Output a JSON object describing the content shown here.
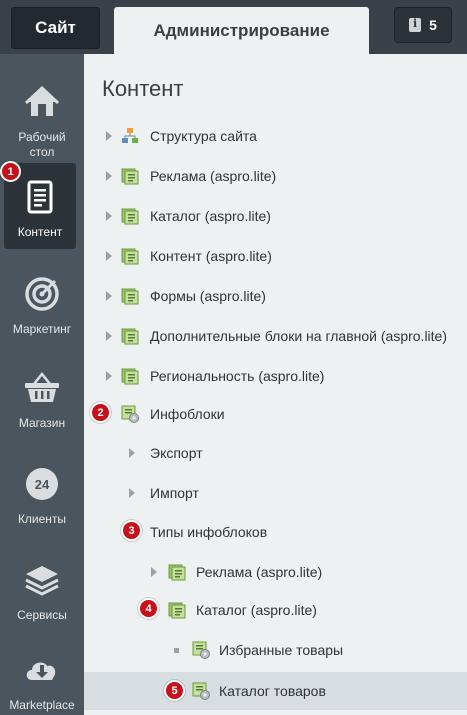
{
  "topbar": {
    "site_tab": "Сайт",
    "admin_tab": "Администрирование",
    "notifications_count": "5"
  },
  "sidebar": {
    "items": [
      {
        "label_line1": "Рабочий",
        "label_line2": "стол",
        "icon": "home-icon"
      },
      {
        "label": "Контент",
        "icon": "document-icon",
        "badge": "1"
      },
      {
        "label": "Маркетинг",
        "icon": "target-icon"
      },
      {
        "label": "Магазин",
        "icon": "basket-icon"
      },
      {
        "label": "Клиенты",
        "icon": "clock-24-icon",
        "icon_text": "24"
      },
      {
        "label": "Сервисы",
        "icon": "layers-icon"
      },
      {
        "label": "Marketplace",
        "icon": "cloud-download-icon"
      }
    ]
  },
  "content": {
    "title": "Контент",
    "tree": [
      {
        "label": "Структура сайта",
        "icon": "site-structure-icon"
      },
      {
        "label": "Реклама (aspro.lite)",
        "icon": "folder-list-icon"
      },
      {
        "label": "Каталог (aspro.lite)",
        "icon": "folder-list-icon"
      },
      {
        "label": "Контент (aspro.lite)",
        "icon": "folder-list-icon"
      },
      {
        "label": "Формы (aspro.lite)",
        "icon": "folder-list-icon"
      },
      {
        "label": "Дополнительные блоки на главной (aspro.lite)",
        "icon": "folder-list-icon"
      },
      {
        "label": "Региональность (aspro.lite)",
        "icon": "folder-list-icon"
      },
      {
        "label": "Инфоблоки",
        "icon": "infoblock-gear-icon",
        "badge": "2"
      },
      {
        "label": "Экспорт"
      },
      {
        "label": "Импорт"
      },
      {
        "label": "Типы инфоблоков",
        "badge": "3"
      },
      {
        "label": "Реклама (aspro.lite)",
        "icon": "folder-list-icon"
      },
      {
        "label": "Каталог (aspro.lite)",
        "icon": "folder-list-icon",
        "badge": "4"
      },
      {
        "label": "Избранные товары",
        "icon": "infoblock-gear-icon"
      },
      {
        "label": "Каталог товаров",
        "icon": "infoblock-gear-icon",
        "badge": "5"
      }
    ]
  },
  "colors": {
    "sidebar_bg": "#4b555d",
    "topbar_bg": "#3a4249",
    "content_bg": "#eef1f2",
    "badge_red": "#c8101a",
    "selected_row": "#d7dde1"
  }
}
